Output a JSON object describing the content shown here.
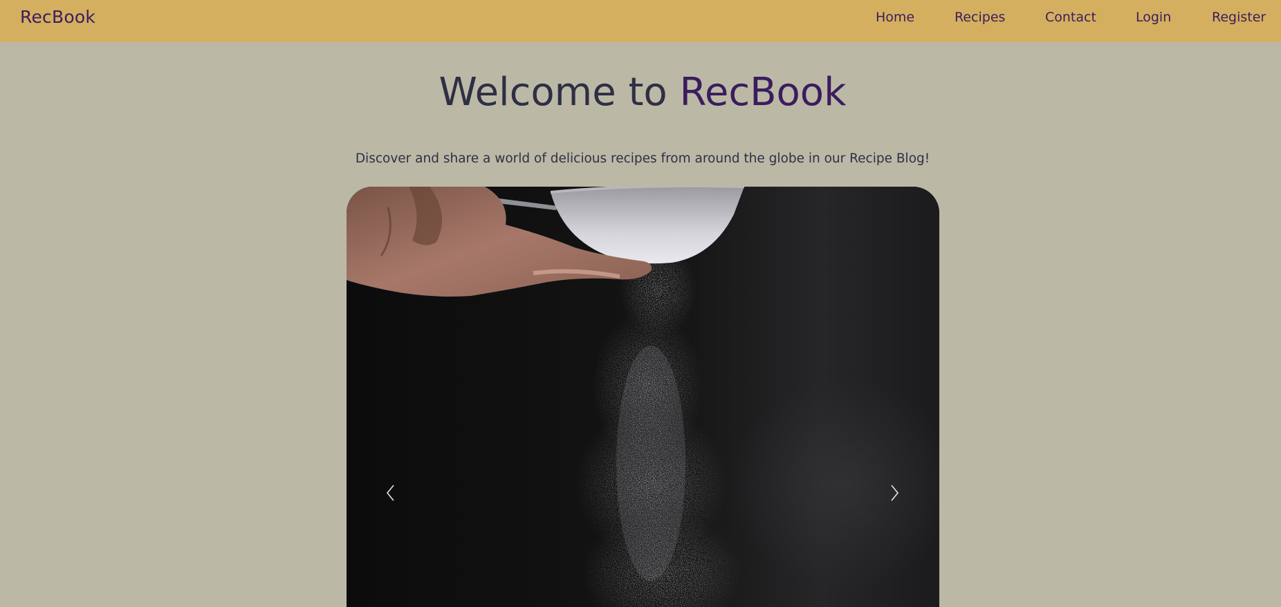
{
  "navbar": {
    "brand": "RecBook",
    "links": [
      {
        "label": "Home"
      },
      {
        "label": "Recipes"
      },
      {
        "label": "Contact"
      },
      {
        "label": "Login"
      },
      {
        "label": "Register"
      }
    ]
  },
  "hero": {
    "title_prefix": "Welcome to",
    "title_accent": "RecBook",
    "subtitle": "Discover and share a world of delicious recipes from around the globe in our Recipe Blog!"
  },
  "carousel": {
    "prev_icon": "chevron-left-icon",
    "next_icon": "chevron-right-icon"
  },
  "colors": {
    "page_background": "#bbb9a6",
    "navbar_background": "#d4af5f",
    "brand_purple": "#3b1c5e",
    "heading_text": "#2e2f44"
  }
}
